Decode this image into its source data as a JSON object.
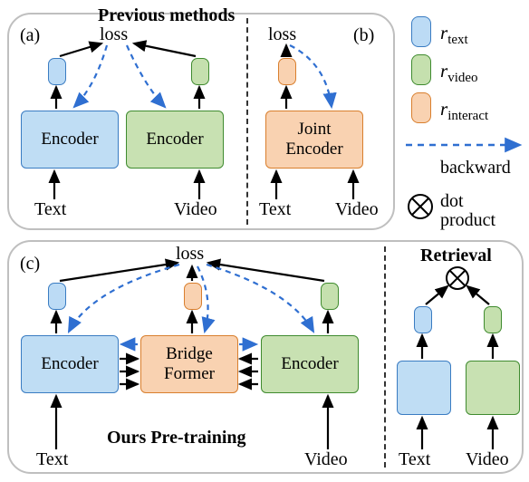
{
  "top": {
    "title": "Previous methods",
    "a_label": "(a)",
    "b_label": "(b)",
    "loss_a": "loss",
    "loss_b": "loss",
    "encoder_text": "Encoder",
    "encoder_video": "Encoder",
    "joint_encoder": "Joint\nEncoder",
    "text_a": "Text",
    "video_a": "Video",
    "text_b": "Text",
    "video_b": "Video"
  },
  "bottom": {
    "c_label": "(c)",
    "loss_c": "loss",
    "encoder_text": "Encoder",
    "bridge": "Bridge\nFormer",
    "encoder_video": "Encoder",
    "ours_title": "Ours Pre-training",
    "text_c": "Text",
    "video_c": "Video",
    "retrieval_title": "Retrieval",
    "text_r": "Text",
    "video_r": "Video"
  },
  "legend": {
    "r_text": "r",
    "r_text_sub": "text",
    "r_video": "r",
    "r_video_sub": "video",
    "r_interact": "r",
    "r_interact_sub": "interact",
    "backward": "backward",
    "dot": "dot",
    "product": "product"
  }
}
